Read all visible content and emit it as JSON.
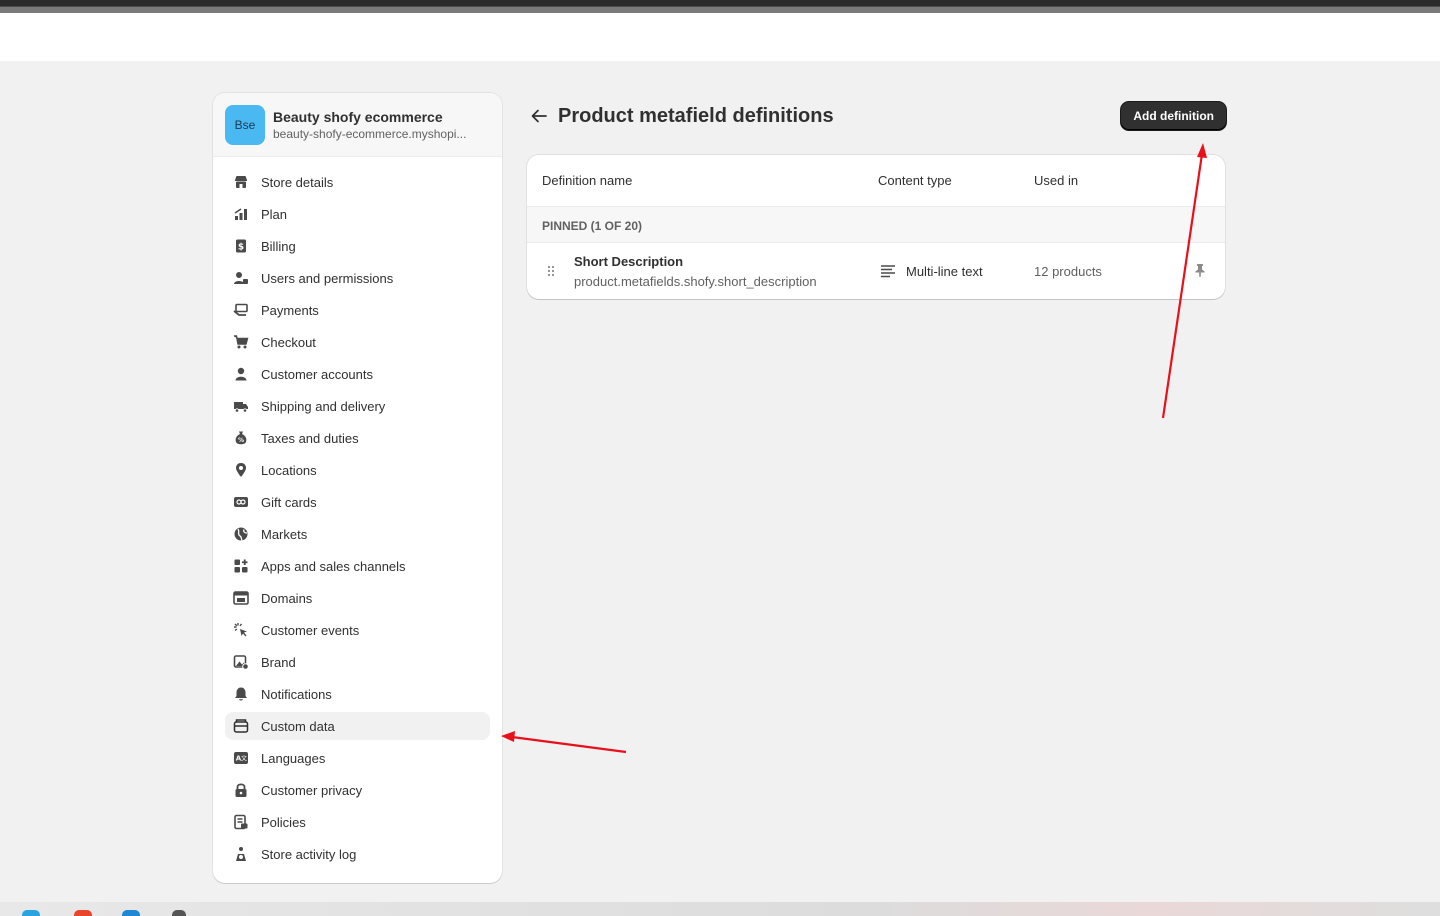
{
  "store": {
    "initials": "Bse",
    "name": "Beauty shofy ecommerce",
    "domain": "beauty-shofy-ecommerce.myshopi..."
  },
  "nav": [
    {
      "label": "Store details",
      "icon": "store-icon"
    },
    {
      "label": "Plan",
      "icon": "plan-icon"
    },
    {
      "label": "Billing",
      "icon": "billing-icon"
    },
    {
      "label": "Users and permissions",
      "icon": "users-icon"
    },
    {
      "label": "Payments",
      "icon": "payments-icon"
    },
    {
      "label": "Checkout",
      "icon": "cart-icon"
    },
    {
      "label": "Customer accounts",
      "icon": "person-icon"
    },
    {
      "label": "Shipping and delivery",
      "icon": "truck-icon"
    },
    {
      "label": "Taxes and duties",
      "icon": "tax-icon"
    },
    {
      "label": "Locations",
      "icon": "location-icon"
    },
    {
      "label": "Gift cards",
      "icon": "gift-card-icon"
    },
    {
      "label": "Markets",
      "icon": "globe-icon"
    },
    {
      "label": "Apps and sales channels",
      "icon": "apps-icon"
    },
    {
      "label": "Domains",
      "icon": "domains-icon"
    },
    {
      "label": "Customer events",
      "icon": "cursor-click-icon"
    },
    {
      "label": "Brand",
      "icon": "brand-icon"
    },
    {
      "label": "Notifications",
      "icon": "bell-icon"
    },
    {
      "label": "Custom data",
      "icon": "custom-data-icon",
      "active": true
    },
    {
      "label": "Languages",
      "icon": "language-icon"
    },
    {
      "label": "Customer privacy",
      "icon": "lock-icon"
    },
    {
      "label": "Policies",
      "icon": "policies-icon"
    },
    {
      "label": "Store activity log",
      "icon": "activity-log-icon"
    }
  ],
  "page": {
    "title": "Product metafield definitions",
    "add_button": "Add definition"
  },
  "table": {
    "headers": {
      "name": "Definition name",
      "content_type": "Content type",
      "used_in": "Used in"
    },
    "pinned_label": "PINNED (1 OF 20)",
    "rows": [
      {
        "name": "Short Description",
        "key": "product.metafields.shofy.short_description",
        "content_type": "Multi-line text",
        "used_in": "12 products"
      }
    ]
  },
  "colors": {
    "accent_dark": "#303030",
    "avatar": "#4ab8f1",
    "annotation": "#e8101a",
    "background": "#f1f1f1"
  }
}
